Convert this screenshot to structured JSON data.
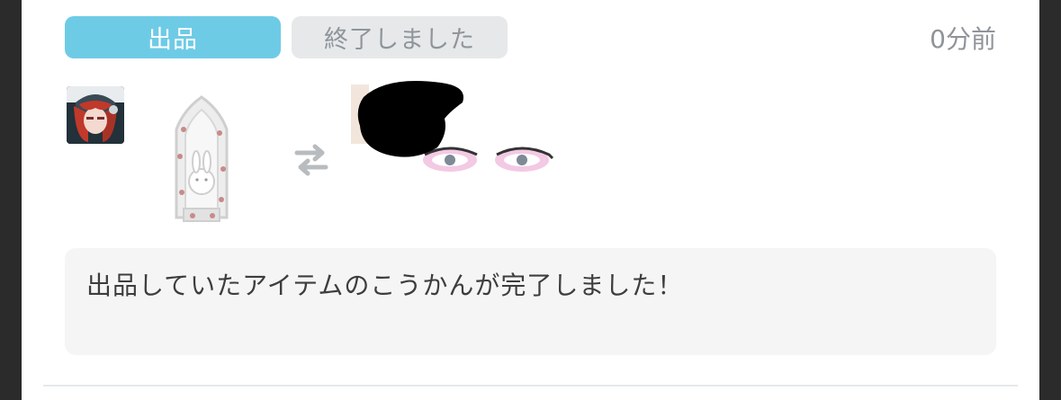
{
  "notification": {
    "category_tag": "出品",
    "status_tag": "終了しました",
    "time_ago": "0分前",
    "message": "出品していたアイテムのこうかんが完了しました！"
  },
  "colors": {
    "category_tag_bg": "#6ecbe6",
    "status_tag_bg": "#e6e8ea",
    "message_bg": "#f5f5f5"
  },
  "icons": {
    "avatar": "user-avatar",
    "listed_item": "bunny-shrine-item",
    "swap": "swap-arrows-icon",
    "received_item": "eyes-item"
  }
}
